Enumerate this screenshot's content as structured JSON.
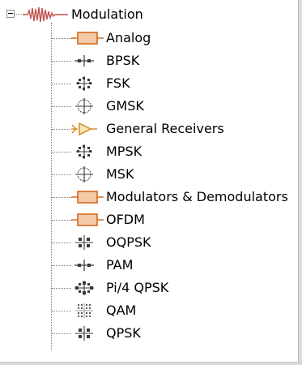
{
  "tree": {
    "root": {
      "label": "Modulation",
      "icon": "modulation-waveform-icon",
      "expanded": true
    },
    "items": [
      {
        "label": "Analog",
        "icon": "library-block-icon"
      },
      {
        "label": "BPSK",
        "icon": "bpsk-constellation-icon"
      },
      {
        "label": "FSK",
        "icon": "fsk-constellation-icon"
      },
      {
        "label": "GMSK",
        "icon": "gmsk-constellation-icon"
      },
      {
        "label": "General Receivers",
        "icon": "receiver-triangle-icon"
      },
      {
        "label": "MPSK",
        "icon": "mpsk-constellation-icon"
      },
      {
        "label": "MSK",
        "icon": "msk-constellation-icon"
      },
      {
        "label": "Modulators & Demodulators",
        "icon": "library-block-icon"
      },
      {
        "label": "OFDM",
        "icon": "library-block-icon"
      },
      {
        "label": "OQPSK",
        "icon": "oqpsk-constellation-icon"
      },
      {
        "label": "PAM",
        "icon": "pam-constellation-icon"
      },
      {
        "label": "Pi/4 QPSK",
        "icon": "pi4-qpsk-constellation-icon"
      },
      {
        "label": "QAM",
        "icon": "qam-constellation-icon"
      },
      {
        "label": "QPSK",
        "icon": "qpsk-constellation-icon"
      }
    ]
  },
  "colors": {
    "block_fill": "#f3c9a6",
    "block_border": "#d46a1e",
    "receiver": "#d4891e",
    "constellation": "#3a3a3a",
    "waveform": "#c0504d",
    "connector": "#7f7f7f"
  }
}
